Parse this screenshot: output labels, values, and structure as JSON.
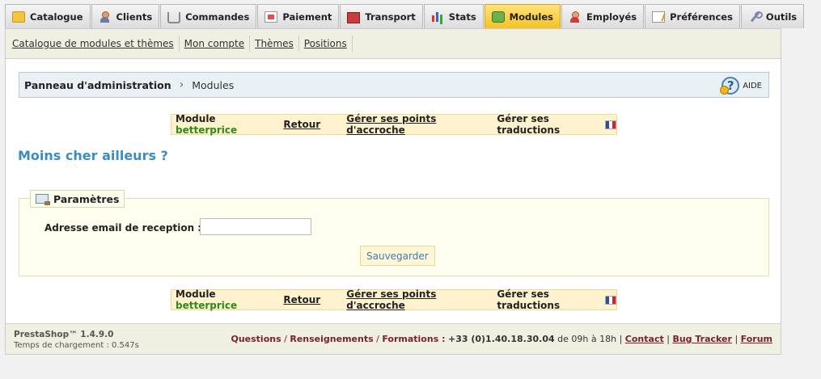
{
  "tabs": [
    {
      "label": "Catalogue",
      "icon": "folder-icon"
    },
    {
      "label": "Clients",
      "icon": "user-icon"
    },
    {
      "label": "Commandes",
      "icon": "cart-icon"
    },
    {
      "label": "Paiement",
      "icon": "payment-icon"
    },
    {
      "label": "Transport",
      "icon": "truck-icon"
    },
    {
      "label": "Stats",
      "icon": "stats-icon"
    },
    {
      "label": "Modules",
      "icon": "puzzle-icon",
      "active": true
    },
    {
      "label": "Employés",
      "icon": "employee-icon"
    },
    {
      "label": "Préférences",
      "icon": "preferences-icon"
    },
    {
      "label": "Outils",
      "icon": "tools-icon"
    }
  ],
  "subnav": [
    "Catalogue de modules et thèmes",
    "Mon compte",
    "Thèmes",
    "Positions"
  ],
  "breadcrumb": {
    "root": "Panneau d'administration",
    "separator": "›",
    "current": "Modules",
    "help_label": "AIDE"
  },
  "module_bar": {
    "prefix": "Module",
    "module_name": "betterprice",
    "back": "Retour",
    "hooks": "Gérer ses points d'accroche",
    "translations": "Gérer ses traductions"
  },
  "page_title": "Moins cher ailleurs ?",
  "form": {
    "legend": "Paramètres",
    "email_label": "Adresse email de reception :",
    "email_value": "",
    "save_label": "Sauvegarder"
  },
  "footer": {
    "product": "PrestaShop™ 1.4.9.0",
    "load_time": "Temps de chargement : 0.547s",
    "questions": "Questions",
    "info": "Renseignements",
    "training": "Formations :",
    "slash": "/",
    "phone": "+33 (0)1.40.18.30.04",
    "hours": "de 09h à 18h",
    "contact": "Contact",
    "bug_tracker": "Bug Tracker",
    "forum": "Forum",
    "pipe": "|"
  },
  "colors": {
    "accent_blue": "#3a8cc4",
    "active_tab": "#f4c224",
    "module_green": "#2f8b17",
    "footer_red": "#7a1f2b"
  }
}
